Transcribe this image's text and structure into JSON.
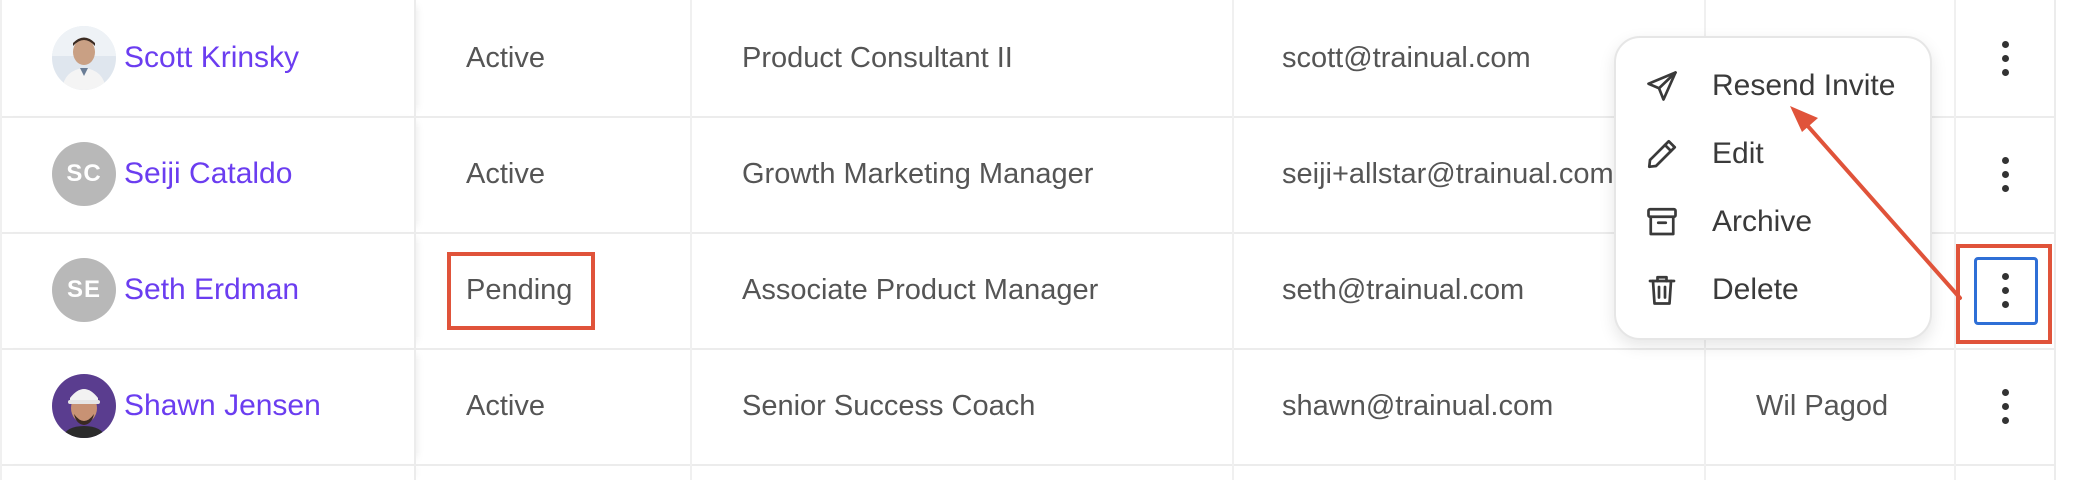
{
  "users": [
    {
      "name": "Scott Krinsky",
      "avatar": "photo",
      "avatar_icon": "person-photo",
      "status": "Active",
      "title": "Product Consultant II",
      "email": "scott@trainual.com",
      "manager": ""
    },
    {
      "name": "Seiji Cataldo",
      "avatar": "initials",
      "initials": "SC",
      "status": "Active",
      "title": "Growth Marketing Manager",
      "email": "seiji+allstar@trainual.com",
      "manager": ""
    },
    {
      "name": "Seth Erdman",
      "avatar": "initials",
      "initials": "SE",
      "status": "Pending",
      "title": "Associate Product Manager",
      "email": "seth@trainual.com",
      "manager": ""
    },
    {
      "name": "Shawn Jensen",
      "avatar": "photo",
      "avatar_icon": "person-photo",
      "status": "Active",
      "title": "Senior Success Coach",
      "email": "shawn@trainual.com",
      "manager": "Wil Pagod"
    }
  ],
  "action_menu": {
    "items": [
      {
        "label": "Resend Invite",
        "icon": "send-icon"
      },
      {
        "label": "Edit",
        "icon": "pencil-icon"
      },
      {
        "label": "Archive",
        "icon": "archive-icon"
      },
      {
        "label": "Delete",
        "icon": "trash-icon"
      }
    ]
  },
  "colors": {
    "name_link": "#6b3df0",
    "annotation": "#e0533a",
    "focus": "#2f6fd6",
    "initials_avatar": "#b8b8b8"
  }
}
